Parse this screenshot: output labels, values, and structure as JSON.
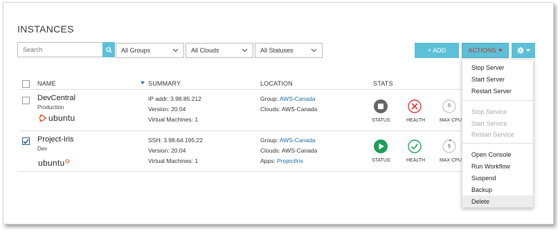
{
  "page": {
    "title": "INSTANCES"
  },
  "toolbar": {
    "search_placeholder": "Search",
    "filter_groups": "All Groups",
    "filter_clouds": "All Clouds",
    "filter_statuses": "All Statuses",
    "add_label": "+ ADD",
    "actions_label": "ACTIONS",
    "accent_color": "#5bc0d8",
    "actions_text_color": "#c0392b"
  },
  "table": {
    "headers": {
      "name": "NAME",
      "summary": "SUMMARY",
      "location": "LOCATION",
      "stats": "STATS"
    },
    "rows": [
      {
        "name": "DevCentral",
        "env": "Production",
        "logo": "ubuntu",
        "checked": false,
        "summary": [
          "IP addr: 3.98.85.212",
          "Version: 20.04",
          "Virtual Machines: 1"
        ],
        "location": [
          {
            "label": "Group: ",
            "value": "AWS-Canada",
            "link": true
          },
          {
            "label": "Clouds: ",
            "value": "AWS-Canada",
            "link": false
          }
        ],
        "stats": {
          "status_label": "STATUS",
          "health_label": "HEALTH",
          "cpu_label": "MAX CPU",
          "cpu_value": "0",
          "status_icon": "stopped-icon",
          "health_icon": "error-x-icon"
        }
      },
      {
        "name": "Project-Iris",
        "env": "Dev",
        "logo": "ubuntu",
        "checked": true,
        "summary": [
          "SSH: 3.98.64.195:22",
          "Version: 20.04",
          "Virtual Machines: 1"
        ],
        "location": [
          {
            "label": "Group: ",
            "value": "AWS-Canada",
            "link": true
          },
          {
            "label": "Clouds: ",
            "value": "AWS-Canada",
            "link": false
          },
          {
            "label": "Apps: ",
            "value": "ProjectIris",
            "link": true
          }
        ],
        "stats": {
          "status_label": "STATUS",
          "health_label": "HEALTH",
          "cpu_label": "MAX CPU",
          "cpu_value": "5",
          "status_icon": "running-icon",
          "health_icon": "healthy-check-icon"
        }
      }
    ]
  },
  "actions_menu": {
    "server": [
      "Stop Server",
      "Start Server",
      "Restart Server"
    ],
    "service": [
      "Stop Service",
      "Start Service",
      "Restart Service"
    ],
    "other": [
      "Open Console",
      "Run Workflow",
      "Suspend",
      "Backup",
      "Delete"
    ]
  }
}
